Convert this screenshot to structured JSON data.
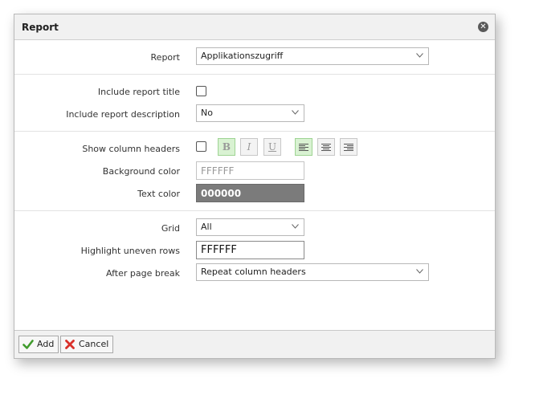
{
  "dialog": {
    "title": "Report",
    "close_icon": "close-icon"
  },
  "report": {
    "label": "Report",
    "value": "Applikationszugriff"
  },
  "include_title": {
    "label": "Include report title",
    "checked": false
  },
  "include_description": {
    "label": "Include report description",
    "value": "No"
  },
  "column_headers": {
    "label": "Show column headers",
    "checked": false,
    "format_buttons": [
      {
        "name": "bold-button",
        "glyph": "B",
        "active": true
      },
      {
        "name": "italic-button",
        "glyph": "I",
        "active": false
      },
      {
        "name": "underline-button",
        "glyph": "U",
        "active": false
      },
      {
        "name": "align-left-button",
        "icon": "align-left-icon",
        "active": true
      },
      {
        "name": "align-center-button",
        "icon": "align-center-icon",
        "active": false
      },
      {
        "name": "align-right-button",
        "icon": "align-right-icon",
        "active": false
      }
    ]
  },
  "background_color": {
    "label": "Background color",
    "value": "FFFFFF",
    "swatch": "#ffffff"
  },
  "text_color": {
    "label": "Text color",
    "value": "000000",
    "swatch": "#7b7b7b"
  },
  "grid": {
    "label": "Grid",
    "value": "All"
  },
  "highlight_uneven_rows": {
    "label": "Highlight uneven rows",
    "value": "FFFFFF"
  },
  "after_page_break": {
    "label": "After page break",
    "value": "Repeat column headers"
  },
  "footer": {
    "add_label": "Add",
    "cancel_label": "Cancel"
  }
}
